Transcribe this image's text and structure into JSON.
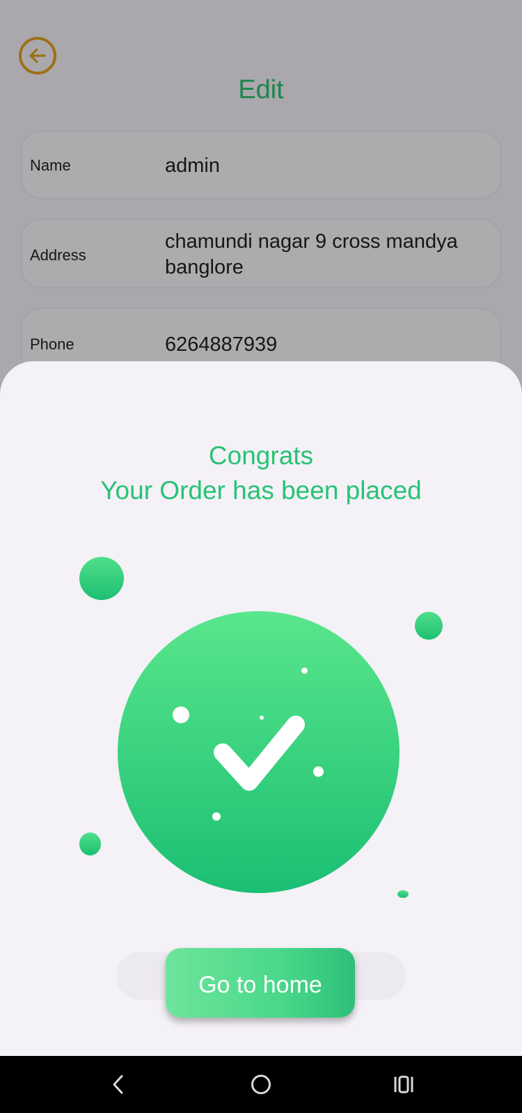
{
  "background": {
    "title": "Edit",
    "fields": [
      {
        "label": "Name",
        "value": "admin"
      },
      {
        "label": "Address",
        "value": "chamundi nagar 9 cross mandya banglore"
      },
      {
        "label": "Phone",
        "value": "6264887939"
      }
    ]
  },
  "sheet": {
    "message_line1": "Congrats",
    "message_line2": "Your Order has been placed",
    "button_label": "Go to home"
  },
  "colors": {
    "accent_green": "#27c374",
    "back_icon": "#e1a123",
    "background": "#f4f1f7"
  },
  "icons": {
    "back": "arrow-left-circle-icon",
    "success": "checkmark-icon",
    "nav_back": "chevron-left-icon",
    "nav_home": "circle-home-icon",
    "nav_recent": "recent-apps-icon"
  }
}
